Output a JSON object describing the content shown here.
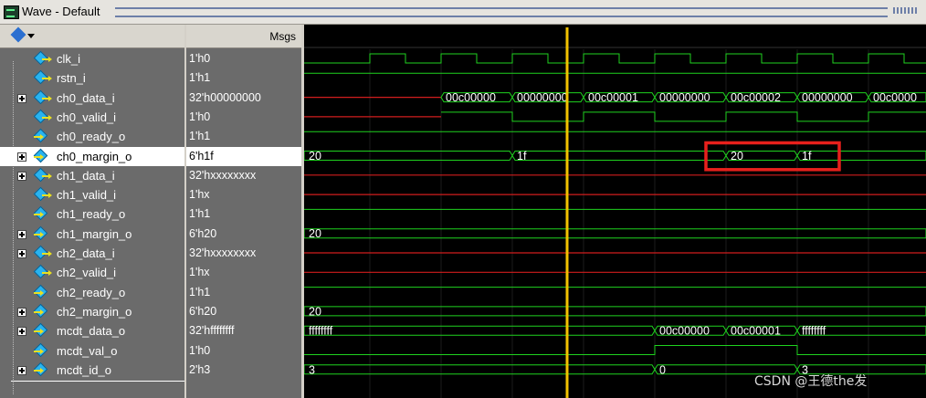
{
  "window": {
    "title": "Wave - Default"
  },
  "header": {
    "msgs_label": "Msgs"
  },
  "signals": [
    {
      "name": "clk_i",
      "value": "1'h0",
      "expandable": false,
      "dir": "in"
    },
    {
      "name": "rstn_i",
      "value": "1'h1",
      "expandable": false,
      "dir": "in"
    },
    {
      "name": "ch0_data_i",
      "value": "32'h00000000",
      "expandable": true,
      "dir": "in"
    },
    {
      "name": "ch0_valid_i",
      "value": "1'h0",
      "expandable": false,
      "dir": "in"
    },
    {
      "name": "ch0_ready_o",
      "value": "1'h1",
      "expandable": false,
      "dir": "out"
    },
    {
      "name": "ch0_margin_o",
      "value": "6'h1f",
      "expandable": true,
      "dir": "out",
      "selected": true
    },
    {
      "name": "ch1_data_i",
      "value": "32'hxxxxxxxx",
      "expandable": true,
      "dir": "in"
    },
    {
      "name": "ch1_valid_i",
      "value": "1'hx",
      "expandable": false,
      "dir": "in"
    },
    {
      "name": "ch1_ready_o",
      "value": "1'h1",
      "expandable": false,
      "dir": "out"
    },
    {
      "name": "ch1_margin_o",
      "value": "6'h20",
      "expandable": true,
      "dir": "out"
    },
    {
      "name": "ch2_data_i",
      "value": "32'hxxxxxxxx",
      "expandable": true,
      "dir": "in"
    },
    {
      "name": "ch2_valid_i",
      "value": "1'hx",
      "expandable": false,
      "dir": "in"
    },
    {
      "name": "ch2_ready_o",
      "value": "1'h1",
      "expandable": false,
      "dir": "out"
    },
    {
      "name": "ch2_margin_o",
      "value": "6'h20",
      "expandable": true,
      "dir": "out"
    },
    {
      "name": "mcdt_data_o",
      "value": "32'hffffffff",
      "expandable": true,
      "dir": "out"
    },
    {
      "name": "mcdt_val_o",
      "value": "1'h0",
      "expandable": false,
      "dir": "out"
    },
    {
      "name": "mcdt_id_o",
      "value": "2'h3",
      "expandable": true,
      "dir": "out"
    }
  ],
  "waves": {
    "time_range": [
      0,
      681
    ],
    "cursor_t": 288,
    "highlight": {
      "t0": 440,
      "t1": 586,
      "rows": [
        5,
        5
      ],
      "color": "#e8201c"
    },
    "rows": [
      {
        "kind": "clock",
        "period": 78,
        "first_rise": 72,
        "color": "#1fd21f"
      },
      {
        "kind": "bit",
        "color": "#1fd21f",
        "init": 1,
        "edges": []
      },
      {
        "kind": "bus",
        "color": "#1fd21f",
        "pre_color": "#d11d1d",
        "pre_until": 150,
        "segments": [
          {
            "t0": 150,
            "t1": 228,
            "label": "00c00000"
          },
          {
            "t0": 228,
            "t1": 306,
            "label": "00000000"
          },
          {
            "t0": 306,
            "t1": 384,
            "label": "00c00001"
          },
          {
            "t0": 384,
            "t1": 462,
            "label": "00000000"
          },
          {
            "t0": 462,
            "t1": 540,
            "label": "00c00002"
          },
          {
            "t0": 540,
            "t1": 618,
            "label": "00000000"
          },
          {
            "t0": 618,
            "t1": 681,
            "label": "00c0000"
          }
        ]
      },
      {
        "kind": "bit",
        "color": "#1fd21f",
        "pre_color": "#d11d1d",
        "pre_until": 150,
        "init": 0,
        "edges": [
          150,
          228,
          306,
          384,
          462,
          540,
          618
        ]
      },
      {
        "kind": "bit",
        "color": "#1fd21f",
        "init": 1,
        "edges": []
      },
      {
        "kind": "bus",
        "color": "#1fd21f",
        "segments": [
          {
            "t0": 0,
            "t1": 228,
            "label": "20"
          },
          {
            "t0": 228,
            "t1": 462,
            "label": "1f"
          },
          {
            "t0": 462,
            "t1": 540,
            "label": "20"
          },
          {
            "t0": 540,
            "t1": 681,
            "label": "1f"
          }
        ]
      },
      {
        "kind": "xline",
        "color": "#d11d1d"
      },
      {
        "kind": "xline",
        "color": "#d11d1d"
      },
      {
        "kind": "bit",
        "color": "#1fd21f",
        "init": 1,
        "edges": []
      },
      {
        "kind": "bus",
        "color": "#1fd21f",
        "segments": [
          {
            "t0": 0,
            "t1": 681,
            "label": "20"
          }
        ]
      },
      {
        "kind": "xline",
        "color": "#d11d1d"
      },
      {
        "kind": "xline",
        "color": "#d11d1d"
      },
      {
        "kind": "bit",
        "color": "#1fd21f",
        "init": 1,
        "edges": []
      },
      {
        "kind": "bus",
        "color": "#1fd21f",
        "segments": [
          {
            "t0": 0,
            "t1": 681,
            "label": "20"
          }
        ]
      },
      {
        "kind": "bus",
        "color": "#1fd21f",
        "segments": [
          {
            "t0": 0,
            "t1": 384,
            "label": "ffffffff"
          },
          {
            "t0": 384,
            "t1": 462,
            "label": "00c00000"
          },
          {
            "t0": 462,
            "t1": 540,
            "label": "00c00001"
          },
          {
            "t0": 540,
            "t1": 681,
            "label": "ffffffff"
          }
        ]
      },
      {
        "kind": "bit",
        "color": "#1fd21f",
        "init": 0,
        "edges": [
          384,
          540
        ]
      },
      {
        "kind": "bus",
        "color": "#1fd21f",
        "segments": [
          {
            "t0": 0,
            "t1": 384,
            "label": "3"
          },
          {
            "t0": 384,
            "t1": 540,
            "label": "0"
          },
          {
            "t0": 540,
            "t1": 681,
            "label": "3"
          }
        ]
      }
    ]
  },
  "watermark": "CSDN @王德the发"
}
